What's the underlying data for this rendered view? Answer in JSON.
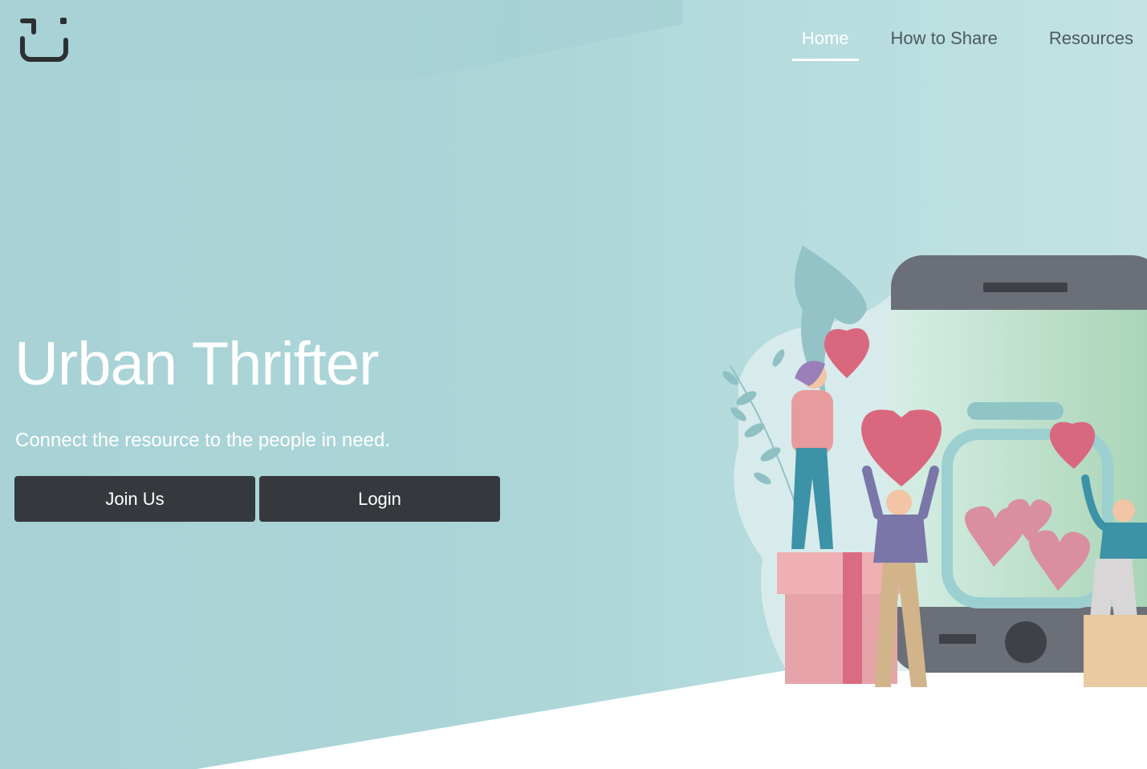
{
  "nav": {
    "items": [
      {
        "label": "Home",
        "active": true
      },
      {
        "label": "How to Share",
        "active": false
      },
      {
        "label": "Resources",
        "active": false
      }
    ]
  },
  "hero": {
    "title": "Urban Thrifter",
    "subtitle": "Connect the resource to the people in need.",
    "join_label": "Join Us",
    "login_label": "Login"
  },
  "icons": {
    "logo": "brand-logo-icon",
    "illustration": "people-sharing-hearts-phone-illustration"
  },
  "colors": {
    "background": "#a9d3d6",
    "button": "#35393e",
    "accent_text": "#ffffff",
    "nav_text": "#4b5a5e"
  }
}
